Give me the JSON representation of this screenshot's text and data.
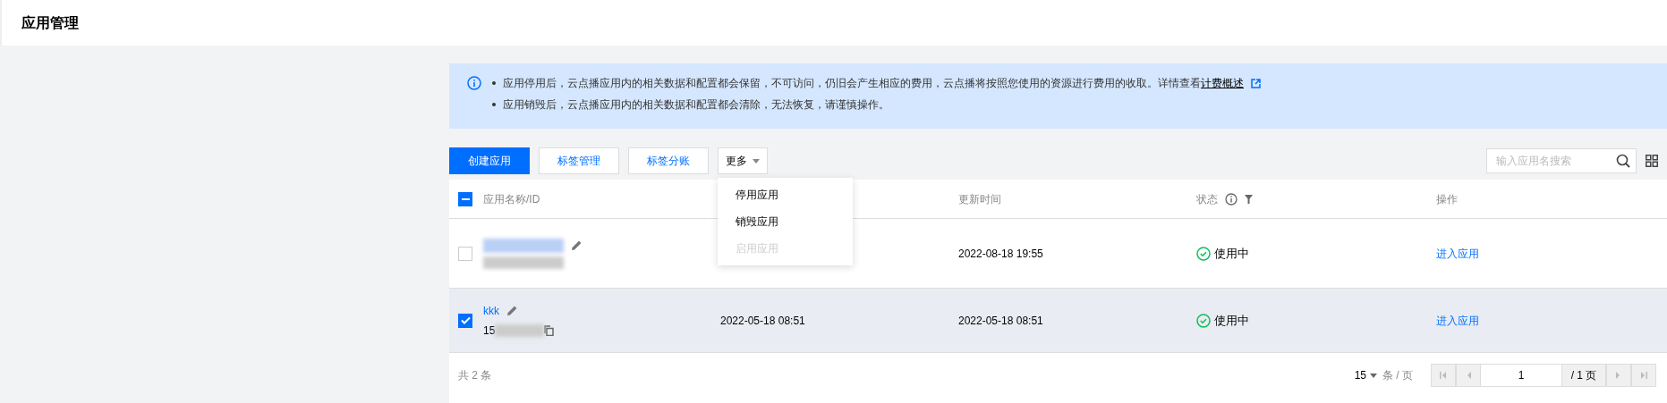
{
  "page_title": "应用管理",
  "notice": {
    "items": [
      {
        "text": "应用停用后，云点播应用内的相关数据和配置都会保留，不可访问，仍旧会产生相应的费用，云点播将按照您使用的资源进行费用的收取。详情查看",
        "link": "计费概述"
      },
      {
        "text": "应用销毁后，云点播应用内的相关数据和配置都会清除，无法恢复，请谨慎操作。"
      }
    ]
  },
  "toolbar": {
    "buttons": [
      {
        "label": "创建应用",
        "kind": "primary"
      },
      {
        "label": "标签管理",
        "kind": "default"
      },
      {
        "label": "标签分账",
        "kind": "default"
      },
      {
        "label": "更多",
        "kind": "dropdown"
      }
    ],
    "search": {
      "placeholder": "输入应用名搜索"
    }
  },
  "menu": [
    {
      "label": "停用应用",
      "disabled": false
    },
    {
      "label": "销毁应用",
      "disabled": false
    },
    {
      "label": "启用应用",
      "disabled": true
    }
  ],
  "table": {
    "columns": [
      {
        "label": "应用名称/ID"
      },
      {},
      {
        "label": "更新时间"
      },
      {
        "label": "状态"
      },
      {
        "label": "操作"
      }
    ],
    "header_indeterminate": true,
    "rows": [
      {
        "selected": false,
        "updated": "2022-08-18 19:55",
        "status": "使用中",
        "action": "进入应用"
      },
      {
        "selected": true,
        "name": "kkk",
        "id": "15",
        "created": "2022-05-18 08:51",
        "updated": "2022-05-18 08:51",
        "status": "使用中",
        "action": "进入应用"
      }
    ]
  },
  "footer": {
    "total": "共 2 条",
    "page_size": "15",
    "per_page": "条 / 页",
    "page": "1",
    "pages": "/ 1 页"
  }
}
